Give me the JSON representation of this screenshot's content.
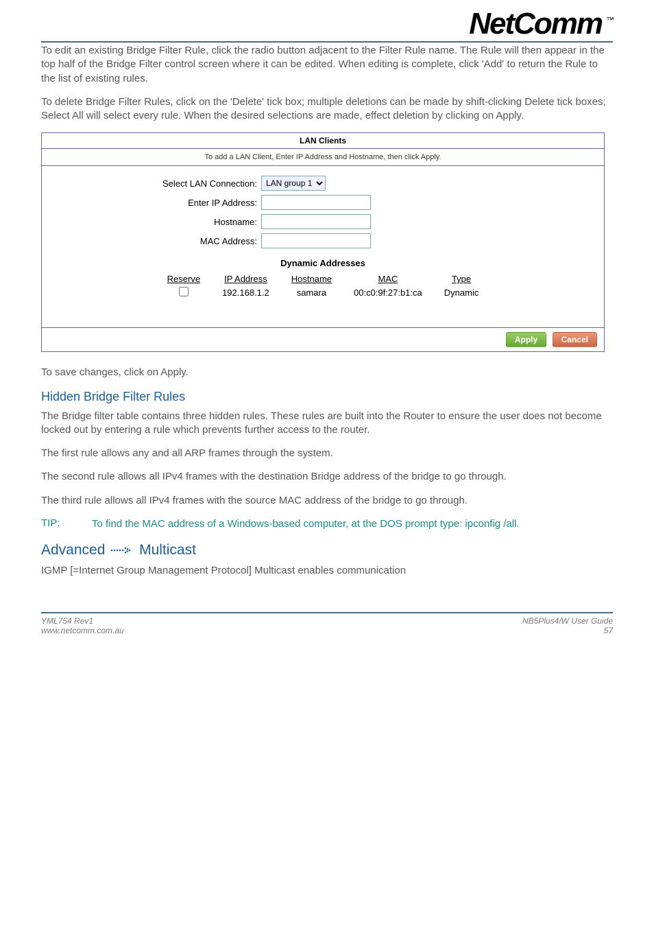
{
  "logo": {
    "text": "NetComm",
    "tm": "™"
  },
  "paragraphs": {
    "p1": "To edit an existing Bridge Filter Rule, click the radio button adjacent to the Filter Rule name.  The Rule will then appear in the top half of the Bridge Filter control screen where it can be edited. When editing is complete, click 'Add' to return the Rule to the list of existing rules.",
    "p2": "To delete Bridge Filter Rules, click on the 'Delete' tick box; multiple deletions can be made by shift-clicking Delete tick boxes; Select All will select every rule.  When the desired selections are made, effect deletion by clicking on Apply.",
    "p3": "To save changes, click on Apply.",
    "hidden_title": "Hidden Bridge Filter Rules",
    "p4": "The Bridge filter table contains three hidden rules. These rules are built into the Router to ensure the user does not become locked out by entering a rule which prevents further access to the router.",
    "p5": "The first rule allows any and all ARP frames through the system.",
    "p6": "The second rule allows all IPv4 frames with the destination Bridge address of the bridge to go through.",
    "p7": "The third rule allows all IPv4 frames with the source MAC address of the bridge to go through.",
    "tip_label": "TIP:",
    "tip_text": "To find the MAC address of a Windows-based computer, at the DOS prompt type: ipconfig /all.",
    "adv_prefix": "Advanced",
    "adv_suffix": "Multicast",
    "p8": "IGMP [=Internet Group Management Protocol] Multicast enables communication"
  },
  "panel": {
    "title": "LAN Clients",
    "subtitle": "To add a LAN Client, Enter IP Address and Hostname, then click Apply.",
    "labels": {
      "select_conn": "Select LAN Connection:",
      "enter_ip": "Enter IP Address:",
      "hostname": "Hostname:",
      "mac": "MAC Address:"
    },
    "select_value": "LAN group 1",
    "dyn_title": "Dynamic Addresses",
    "headers": {
      "reserve": "Reserve",
      "ip": "IP Address",
      "host": "Hostname",
      "mac": "MAC",
      "type": "Type"
    },
    "row": {
      "ip": "192.168.1.2",
      "host": "samara",
      "mac": "00:c0:9f:27:b1:ca",
      "type": "Dynamic"
    },
    "buttons": {
      "apply": "Apply",
      "cancel": "Cancel"
    }
  },
  "footer": {
    "left1": "YML754 Rev1",
    "left2": "www.netcomm.com.au",
    "right1": "NB5Plus4/W User Guide",
    "right2": "57"
  }
}
